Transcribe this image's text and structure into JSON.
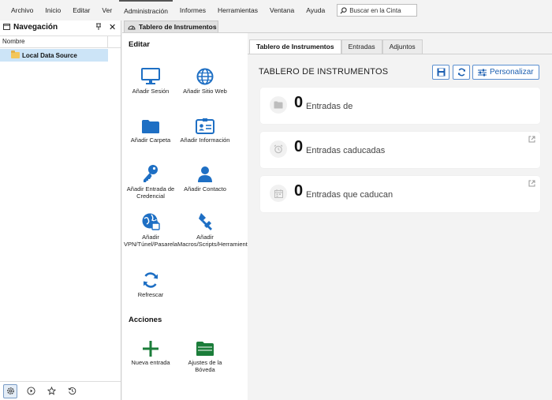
{
  "menu": {
    "items": [
      "Archivo",
      "Inicio",
      "Editar",
      "Ver",
      "Administración",
      "Informes",
      "Herramientas",
      "Ventana",
      "Ayuda"
    ],
    "active_index": 4,
    "search_placeholder": "Buscar en la Cinta"
  },
  "nav": {
    "title": "Navegación",
    "column_header": "Nombre",
    "tree": [
      {
        "label": "Local Data Source",
        "selected": true
      }
    ],
    "bottom_buttons": [
      "settings-icon",
      "play-icon",
      "star-icon",
      "history-icon"
    ]
  },
  "document_tab": {
    "label": "Tablero de Instrumentos"
  },
  "edit_panel": {
    "editar_title": "Editar",
    "acciones_title": "Acciones",
    "actions": {
      "add_session": "Añadir Sesión",
      "add_website": "Añadir Sitio Web",
      "add_folder": "Añadir Carpeta",
      "add_info": "Añadir Información",
      "add_credential": "Añadir Entrada de Credencial",
      "add_contact": "Añadir Contacto",
      "add_vpn": "Añadir VPN/Túnel/Pasarela",
      "add_macros": "Añadir Macros/Scripts/Herramientas",
      "refresh": "Refrescar",
      "new_entry": "Nueva entrada",
      "vault_settings": "Ajustes de la Bóveda"
    }
  },
  "dashboard": {
    "tabs": [
      {
        "label": "Tablero de Instrumentos",
        "active": true
      },
      {
        "label": "Entradas",
        "active": false
      },
      {
        "label": "Adjuntos",
        "active": false
      }
    ],
    "title": "TABLERO DE INSTRUMENTOS",
    "customize_label": "Personalizar",
    "cards": [
      {
        "count": "0",
        "label": "Entradas de",
        "icon": "folder-icon"
      },
      {
        "count": "0",
        "label": "Entradas caducadas",
        "icon": "alarm-clock-icon"
      },
      {
        "count": "0",
        "label": "Entradas que caducan",
        "icon": "calendar-icon"
      }
    ]
  },
  "colors": {
    "accent": "#1e6fc4",
    "selection": "#cce4f7",
    "add_green": "#1b7d3a",
    "folder_yellow": "#f3c65a"
  }
}
